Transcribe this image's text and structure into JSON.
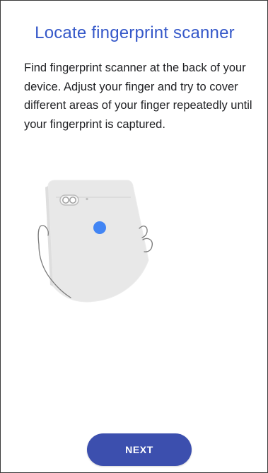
{
  "screen": {
    "title": "Locate fingerprint scanner",
    "description": "Find fingerprint scanner at the back of your device. Adjust your finger and try to cover different areas of your finger repeatedly until your fingerprint is captured.",
    "illustration_icon": "phone-back-fingerprint-illustration",
    "sensor_color": "#4285f4"
  },
  "actions": {
    "next_label": "NEXT",
    "next_color": "#3c4fae"
  }
}
